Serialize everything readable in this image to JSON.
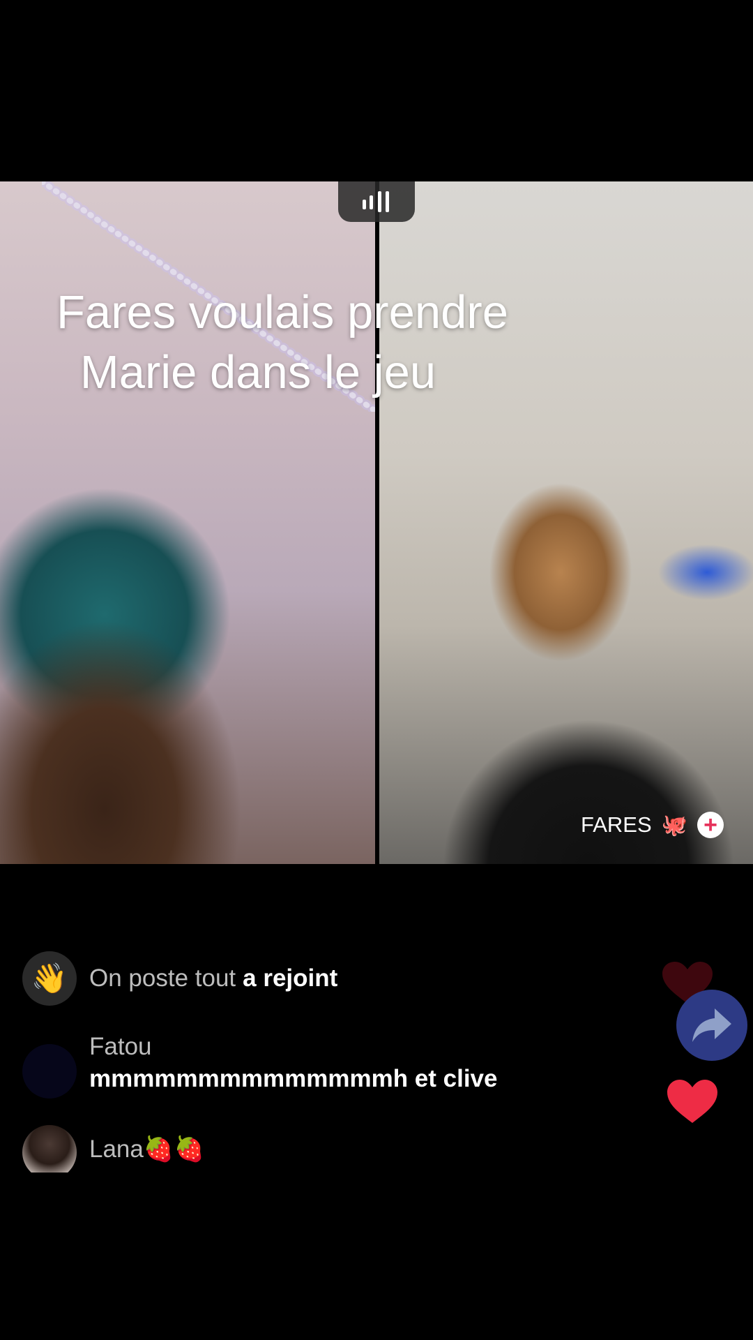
{
  "video": {
    "caption_line_1": "Fares voulais prendre",
    "caption_line_2": "Marie dans le jeu"
  },
  "host": {
    "name": "FARES",
    "emoji": "🐙",
    "follow_symbol": "+"
  },
  "chat": {
    "joined": {
      "user": "On poste tout",
      "action": "a rejoint",
      "icon": "waving-hand-icon"
    },
    "messages": [
      {
        "user": "Fatou",
        "text": "mmmmmmmmmmmmmmh et clive"
      },
      {
        "user": "Lana🍓🍓",
        "text": ""
      }
    ]
  },
  "colors": {
    "heart": "#ee2c45",
    "share_button": "#2d3a85",
    "follow_plus": "#e6345c"
  }
}
